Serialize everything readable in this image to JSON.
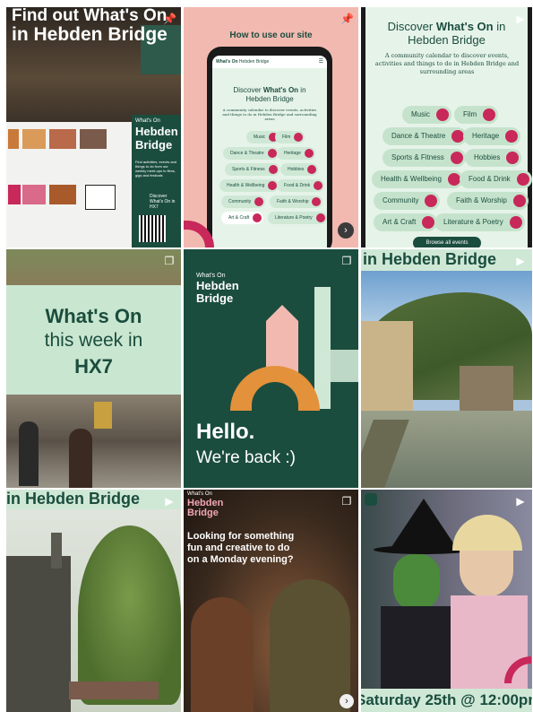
{
  "colors": {
    "brand_green": "#1b4d3e",
    "brand_pink": "#c8285a",
    "mint": "#cfe8d6",
    "peach": "#f2b9b0",
    "orange": "#e3913a"
  },
  "tile1": {
    "overlay_text": "Find out What's On in Hebden Bridge",
    "overlay_line1": "Find out What's On",
    "overlay_line2": "in Hebden Bridge",
    "poster_small": "What's On",
    "poster_title_1": "Hebden",
    "poster_title_2": "Bridge",
    "poster_body": "Find activities, events and things to do from our weekly meet-ups to films, gigs and festivals",
    "poster_cta": "Discover What's On in HX7",
    "icon": "pin-icon"
  },
  "tile2": {
    "heading": "How to use our site",
    "phone_brand_bold": "What's On",
    "phone_brand_rest": "Hebden Bridge",
    "phone_title_1": "Discover",
    "phone_title_bold": "What's On",
    "phone_title_2": "in",
    "phone_title_3": "Hebden Bridge",
    "phone_desc": "A community calendar to discover events, activities and things to do in Hebden Bridge and surrounding areas",
    "pills": [
      "Music",
      "Film",
      "Dance & Theatre",
      "Heritage",
      "Sports & Fitness",
      "Hobbies",
      "Health & Wellbeing",
      "Food & Drink",
      "Community",
      "Faith & Worship",
      "Art & Craft",
      "Literature & Poetry"
    ],
    "icon": "pin-icon",
    "next_icon": "chevron-right-icon"
  },
  "tile3": {
    "title_1": "Discover",
    "title_bold": "What's On",
    "title_2": "in",
    "title_3": "Hebden Bridge",
    "desc": "A community calendar to discover events, activities and things to do in Hebden Bridge and surrounding areas",
    "pills": [
      "Music",
      "Film",
      "Dance & Theatre",
      "Heritage",
      "Sports & Fitness",
      "Hobbies",
      "Health & Wellbeing",
      "Food & Drink",
      "Community",
      "Faith & Worship",
      "Art & Craft",
      "Literature & Poetry"
    ],
    "browse": "Browse all events",
    "icon": "reel-icon"
  },
  "tile4": {
    "line1": "What's On",
    "line2": "this week in",
    "line3": "HX7",
    "icon": "carousel-icon"
  },
  "tile5": {
    "small": "What's On",
    "title_1": "Hebden",
    "title_2": "Bridge",
    "hello": "Hello.",
    "back": "We're back :)",
    "icon": "carousel-icon"
  },
  "tile6": {
    "banner": "in Hebden Bridge",
    "icon": "reel-icon"
  },
  "tile7": {
    "banner": "in Hebden Bridge",
    "icon": "reel-icon"
  },
  "tile8": {
    "small": "What's On",
    "title_1": "Hebden",
    "title_2": "Bridge",
    "question": "Looking for something fun and creative to do on a Monday evening?",
    "icon": "carousel-icon",
    "next_icon": "chevron-right-icon"
  },
  "tile9": {
    "date": "Saturday 25th @ 12:00pm",
    "icon": "reel-icon"
  }
}
